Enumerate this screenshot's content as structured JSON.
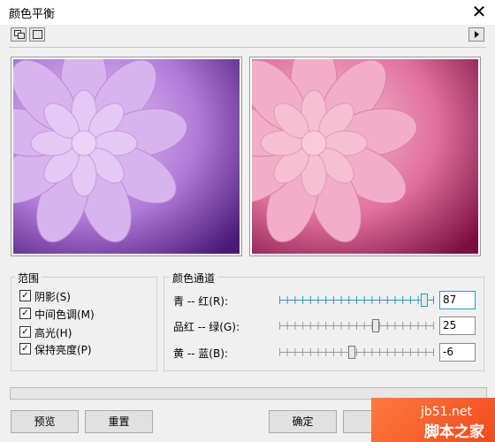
{
  "window": {
    "title": "颜色平衡"
  },
  "toolbar": {
    "icons": [
      "dual-preview-icon",
      "single-preview-icon",
      "expand-arrow-icon"
    ]
  },
  "range": {
    "label": "范围",
    "options": [
      {
        "label": "阴影(S)",
        "checked": true
      },
      {
        "label": "中间色调(M)",
        "checked": true
      },
      {
        "label": "高光(H)",
        "checked": true
      },
      {
        "label": "保持亮度(P)",
        "checked": true
      }
    ]
  },
  "channels": {
    "label": "颜色通道",
    "rows": [
      {
        "label": "青 -- 红(R):",
        "value": "87",
        "min": -100,
        "max": 100,
        "active": true
      },
      {
        "label": "品红 -- 绿(G):",
        "value": "25",
        "min": -100,
        "max": 100,
        "active": false
      },
      {
        "label": "黄 -- 蓝(B):",
        "value": "-6",
        "min": -100,
        "max": 100,
        "active": false
      }
    ]
  },
  "buttons": {
    "preview": "预览",
    "reset": "重置",
    "ok": "确定",
    "cancel": "取"
  },
  "watermark": {
    "line1": "jb51.net",
    "line2": "脚本之家"
  },
  "colors": {
    "accent": "#1ba1c7",
    "watermark": "#f05a24"
  }
}
